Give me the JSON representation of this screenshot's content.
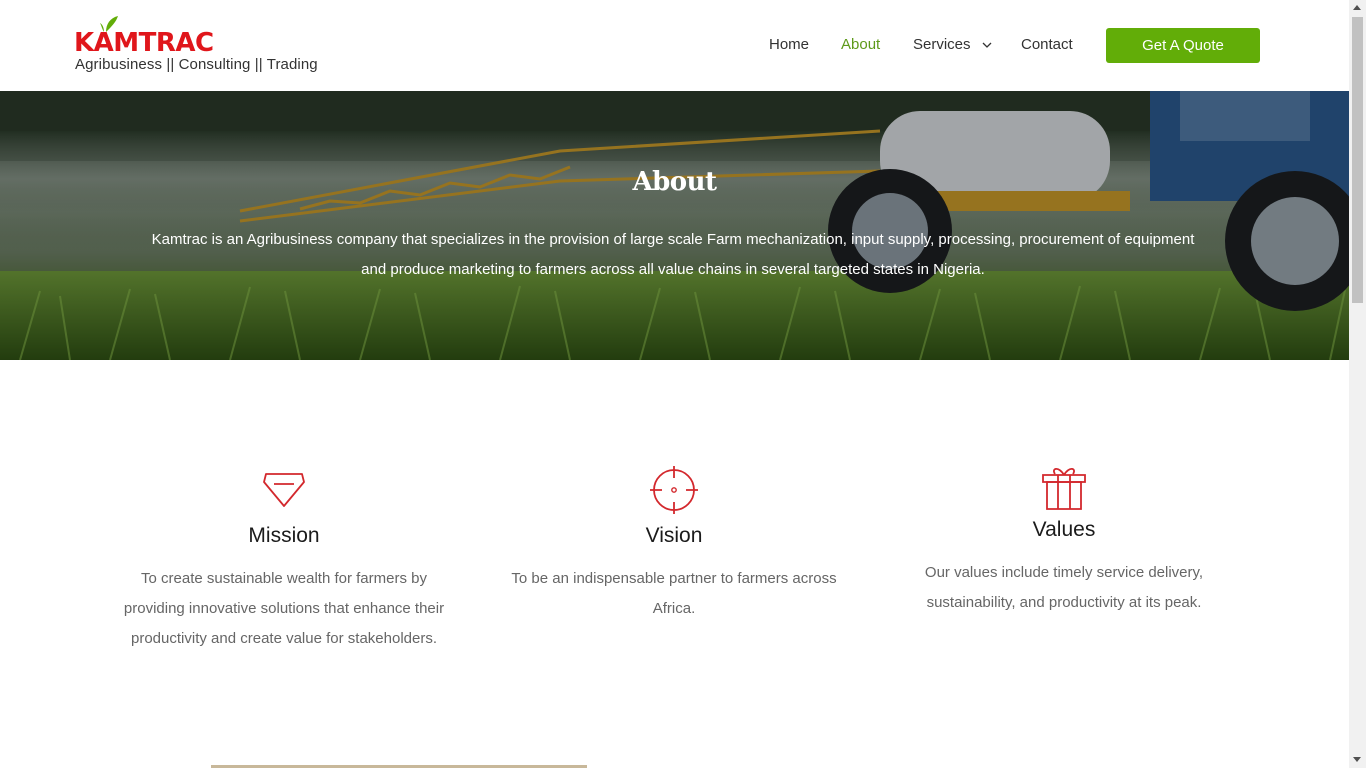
{
  "brand": {
    "logo_text": "KAMTRAC",
    "tagline": "Agribusiness || Consulting || Trading",
    "brand_red": "#e0161b",
    "brand_green": "#62ad08"
  },
  "nav": {
    "items": [
      {
        "label": "Home",
        "active": false
      },
      {
        "label": "About",
        "active": true
      },
      {
        "label": "Services",
        "active": false,
        "has_dropdown": true
      },
      {
        "label": "Contact",
        "active": false
      }
    ],
    "cta_label": "Get A Quote"
  },
  "hero": {
    "title": "About",
    "text": "Kamtrac is an Agribusiness company that specializes in the provision of large scale Farm mechanization, input supply, processing, procurement of equipment and produce marketing to farmers across all value chains in several targeted states in Nigeria."
  },
  "features": [
    {
      "icon": "diamond-icon",
      "title": "Mission",
      "text": "To create sustainable wealth for farmers by providing innovative solutions that enhance their productivity and create value for stakeholders."
    },
    {
      "icon": "crosshair-icon",
      "title": "Vision",
      "text": "To be an indispensable partner to farmers across Africa."
    },
    {
      "icon": "gift-icon",
      "title": "Values",
      "text": "Our values include timely service delivery, sustainability, and productivity at its peak."
    }
  ],
  "icon_color": "#d3282d"
}
